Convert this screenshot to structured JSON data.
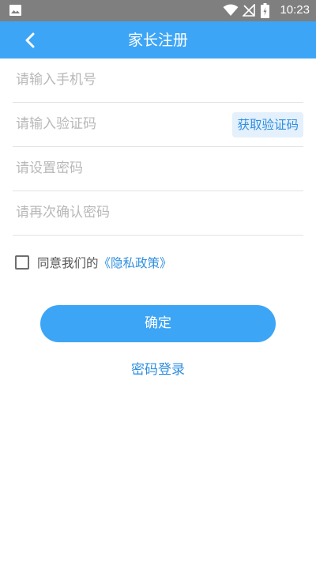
{
  "status_bar": {
    "time": "10:23",
    "icons": [
      "gallery-icon",
      "wifi-icon",
      "no-signal-icon",
      "battery-icon"
    ]
  },
  "header": {
    "title": "家长注册",
    "back_icon": "chevron-left-icon"
  },
  "form": {
    "phone_placeholder": "请输入手机号",
    "code_placeholder": "请输入验证码",
    "get_code_label": "获取验证码",
    "password_placeholder": "请设置密码",
    "confirm_password_placeholder": "请再次确认密码"
  },
  "agreement": {
    "checked": false,
    "prefix": "同意我们的",
    "policy_link": "《隐私政策》"
  },
  "actions": {
    "confirm_label": "确定",
    "password_login_label": "密码登录"
  },
  "colors": {
    "primary": "#3da5f5",
    "link": "#2f8fe0",
    "status_bar": "#7f7f7f",
    "code_button_bg": "#e4f0fc",
    "divider": "#e3e3e3",
    "placeholder": "#b8b8b8"
  }
}
